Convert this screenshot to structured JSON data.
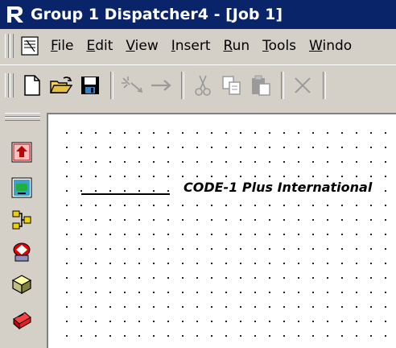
{
  "window": {
    "title": "Group 1 Dispatcher4 - [Job 1]"
  },
  "menubar": {
    "items": [
      {
        "label": "File",
        "accel": "F",
        "rest": "ile"
      },
      {
        "label": "Edit",
        "accel": "E",
        "rest": "dit"
      },
      {
        "label": "View",
        "accel": "V",
        "rest": "iew"
      },
      {
        "label": "Insert",
        "accel": "I",
        "rest": "nsert"
      },
      {
        "label": "Run",
        "accel": "R",
        "rest": "un"
      },
      {
        "label": "Tools",
        "accel": "T",
        "rest": "ools"
      },
      {
        "label": "Windo",
        "accel": "W",
        "rest": "indo"
      }
    ]
  },
  "toolbar": {
    "buttons": [
      "new-icon",
      "open-icon",
      "save-icon",
      "connect-wizard-icon",
      "arrow-icon",
      "cut-icon",
      "copy-icon",
      "paste-icon",
      "delete-icon"
    ]
  },
  "palette": {
    "tools": [
      "input-tool-icon",
      "output-tool-icon",
      "route-tool-icon",
      "process-tool-icon",
      "database-tool-icon",
      "toolbox-icon"
    ]
  },
  "canvas": {
    "node_label": "CODE-1 Plus International"
  },
  "colors": {
    "titlebar": "#0a246a",
    "chrome": "#d4d0c8",
    "canvas": "#ffffff"
  }
}
